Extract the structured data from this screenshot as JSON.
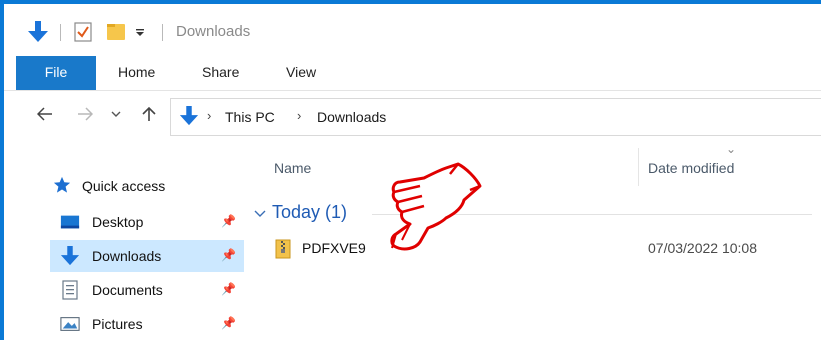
{
  "window": {
    "title": "Downloads",
    "accent_color": "#0a7ad6"
  },
  "quick_access_toolbar": {
    "icons": [
      "download-arrow-icon",
      "properties-check-icon",
      "new-folder-icon",
      "customize-dropdown-icon"
    ]
  },
  "ribbon": {
    "tabs": [
      {
        "label": "File",
        "active_color": "#1979ca"
      },
      {
        "label": "Home"
      },
      {
        "label": "Share"
      },
      {
        "label": "View"
      }
    ]
  },
  "navigation": {
    "buttons": [
      "back-arrow-icon",
      "forward-arrow-icon",
      "recent-dropdown-icon",
      "up-arrow-icon"
    ],
    "breadcrumb": [
      "This PC",
      "Downloads"
    ],
    "separator": "›"
  },
  "sidebar": {
    "quick_access": "Quick access",
    "items": [
      {
        "label": "Desktop",
        "icon": "desktop-icon",
        "pinned": true,
        "selected": false
      },
      {
        "label": "Downloads",
        "icon": "downloads-icon",
        "pinned": true,
        "selected": true
      },
      {
        "label": "Documents",
        "icon": "documents-icon",
        "pinned": true,
        "selected": false
      },
      {
        "label": "Pictures",
        "icon": "pictures-icon",
        "pinned": true,
        "selected": false
      }
    ],
    "selected_color": "#cce8ff"
  },
  "file_list": {
    "columns": [
      "Name",
      "Date modified"
    ],
    "group": {
      "label": "Today (1)"
    },
    "files": [
      {
        "name": "PDFXVE9",
        "date_modified": "07/03/2022 10:08",
        "icon": "zip-folder-icon"
      }
    ]
  },
  "annotation": {
    "icon": "pointing-hand-icon",
    "color": "#e00000"
  }
}
